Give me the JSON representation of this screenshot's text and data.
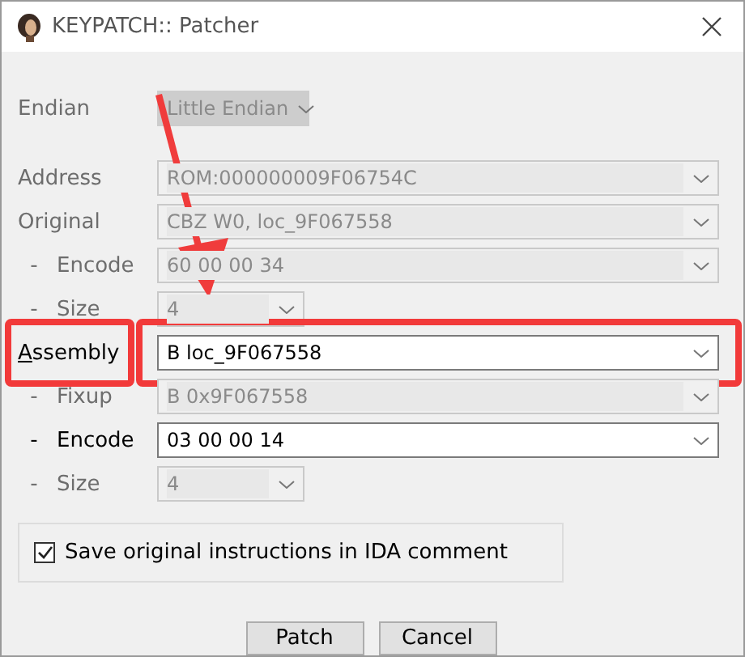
{
  "window": {
    "title": "KEYPATCH:: Patcher"
  },
  "fields": [
    {
      "label": "Endian",
      "value": "Little Endian",
      "kind": "compact",
      "disabled": true,
      "highlighted": false,
      "underline_first": false
    },
    {
      "label": "Address",
      "value": "ROM:000000009F06754C",
      "kind": "wide",
      "disabled": true,
      "highlighted": false,
      "underline_first": false
    },
    {
      "label": "Original",
      "value": "CBZ W0, loc_9F067558",
      "kind": "wide",
      "disabled": true,
      "highlighted": false,
      "underline_first": false
    },
    {
      "label": "Encode",
      "prefix": "-",
      "value": "60 00 00 34",
      "kind": "wide",
      "disabled": true,
      "highlighted": false,
      "underline_first": false
    },
    {
      "label": "Size",
      "prefix": "-",
      "value": "4",
      "kind": "short",
      "disabled": true,
      "highlighted": false,
      "underline_first": false
    },
    {
      "label": "Assembly",
      "value": "B loc_9F067558",
      "kind": "wide",
      "disabled": false,
      "highlighted": true,
      "underline_first": true
    },
    {
      "label": "Fixup",
      "prefix": "-",
      "value": "B 0x9F067558",
      "kind": "wide",
      "disabled": true,
      "highlighted": false,
      "underline_first": false
    },
    {
      "label": "Encode",
      "prefix": "-",
      "value": "03 00 00 14",
      "kind": "wide",
      "disabled": false,
      "highlighted": false,
      "underline_first": false
    },
    {
      "label": "Size",
      "prefix": "-",
      "value": "4",
      "kind": "short",
      "disabled": true,
      "highlighted": false,
      "underline_first": false
    }
  ],
  "option": {
    "label": "Save original instructions in IDA comment",
    "checked": true
  },
  "buttons": [
    "Patch",
    "Cancel"
  ]
}
